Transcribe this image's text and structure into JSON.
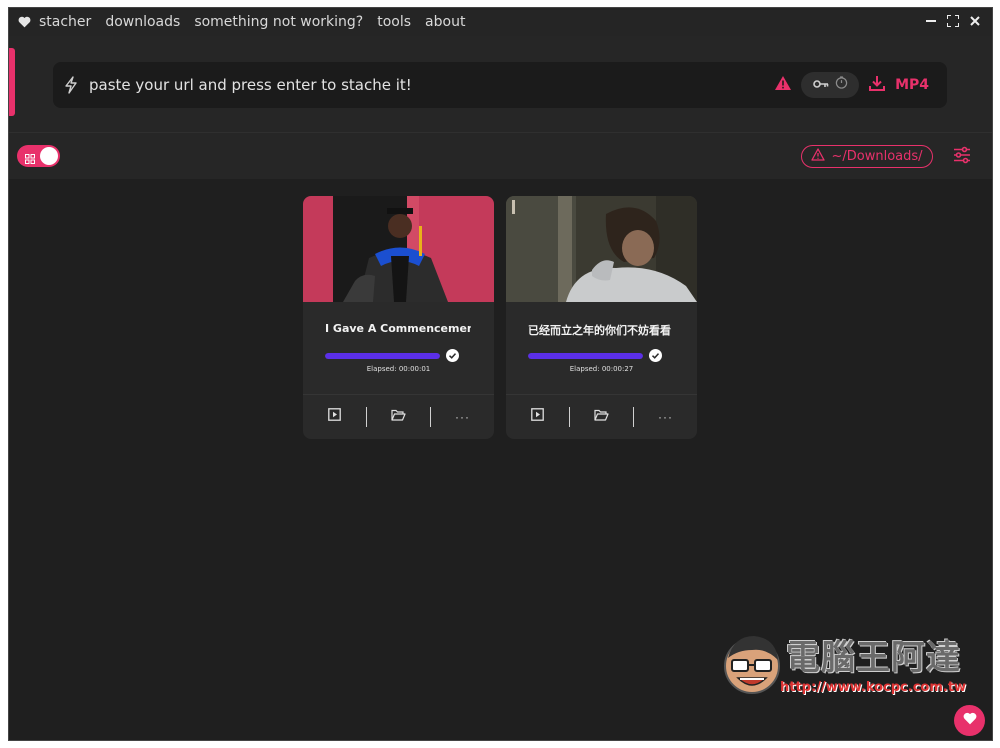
{
  "menu": {
    "items": [
      "stacher",
      "downloads",
      "something not working?",
      "tools",
      "about"
    ]
  },
  "url_bar": {
    "placeholder": "paste your url and press enter to stache it!",
    "format_label": "MP4",
    "icons": [
      "bolt-icon",
      "warning-icon",
      "key-icon",
      "timer-icon",
      "download-icon"
    ]
  },
  "toolbar": {
    "download_path": "~/Downloads/"
  },
  "downloads": [
    {
      "title": "I Gave A Commencement Speech!",
      "progress": 1.0,
      "status": "complete",
      "elapsed": "Elapsed: 00:00:01"
    },
    {
      "title": "已经而立之年的你们不妨看看",
      "progress": 1.0,
      "status": "complete",
      "elapsed": "Elapsed: 00:00:27"
    }
  ],
  "watermark": {
    "title": "電腦王阿達",
    "url": "http://www.kocpc.com.tw"
  },
  "colors": {
    "accent": "#e8316b",
    "progress": "#5b2fe8",
    "background": "#1f1f1f"
  }
}
